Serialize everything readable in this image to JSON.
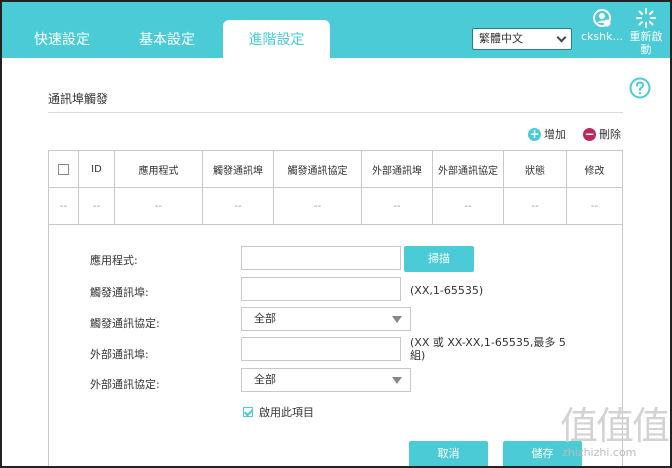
{
  "nav": {
    "tabs": [
      {
        "label": "快速設定"
      },
      {
        "label": "基本設定"
      },
      {
        "label": "進階設定"
      }
    ],
    "language": "繁體中文",
    "user_label": "ckshk...",
    "reboot_label_line1": "重新啟",
    "reboot_label_line2": "動"
  },
  "section": {
    "title": "通訊埠觸發",
    "add_label": "增加",
    "delete_label": "刪除"
  },
  "table": {
    "columns": [
      "ID",
      "應用程式",
      "觸發通訊埠",
      "觸發通訊協定",
      "外部通訊埠",
      "外部通訊協定",
      "狀態",
      "修改"
    ],
    "row": [
      "--",
      "--",
      "--",
      "--",
      "--",
      "--",
      "--",
      "--",
      "--"
    ]
  },
  "form": {
    "app_label": "應用程式:",
    "scan_button": "掃描",
    "trigger_port_label": "觸發通訊埠:",
    "trigger_port_hint": "(XX,1-65535)",
    "trigger_protocol_label": "觸發通訊協定:",
    "trigger_protocol_value": "全部",
    "external_port_label": "外部通訊埠:",
    "external_port_hint_line1": "(XX 或 XX-XX,1-65535,最多 5",
    "external_port_hint_line2": "組)",
    "external_protocol_label": "外部通訊協定:",
    "external_protocol_value": "全部",
    "enable_label": "啟用此項目",
    "cancel_button": "取消",
    "save_button": "儲存"
  },
  "watermark": {
    "text": "值值值",
    "url": "zhizhizhi.com"
  },
  "colors": {
    "accent": "#4acbd6",
    "delete": "#c0265a"
  }
}
